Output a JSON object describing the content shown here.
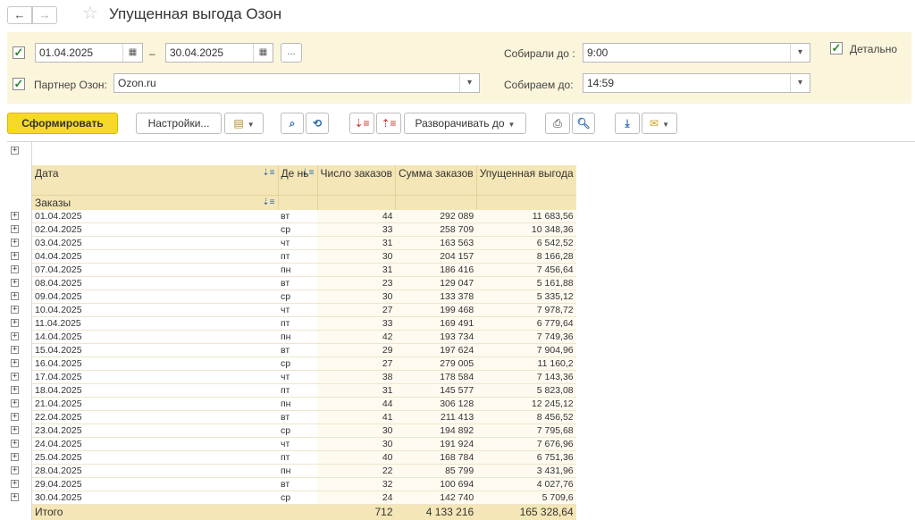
{
  "header": {
    "title": "Упущенная выгода Озон",
    "back_icon": "←",
    "forward_icon": "→",
    "star_icon": "☆"
  },
  "filters": {
    "period_from": "01.04.2025",
    "period_to": "30.04.2025",
    "period_sep": "–",
    "ellipsis": "...",
    "partner_label": "Партнер Озон:",
    "partner_value": "Ozon.ru",
    "collected_label": "Собирали до :",
    "collected_value": "9:00",
    "collecting_label": "Собираем до:",
    "collecting_value": "14:59",
    "detail_label": "Детально",
    "checkmark": "✓"
  },
  "toolbar": {
    "generate": "Сформировать",
    "settings": "Настройки...",
    "expand_to": "Разворачивать до"
  },
  "table": {
    "headers": {
      "date": "Дата",
      "day": "Де нь",
      "orders_count": "Число заказов",
      "orders_sum": "Сумма заказов",
      "lost_profit": "Упущенная выгода"
    },
    "group_label": "Заказы",
    "rows": [
      {
        "date": "01.04.2025",
        "day": "вт",
        "count": "44",
        "sum": "292 089",
        "lost": "11 683,56"
      },
      {
        "date": "02.04.2025",
        "day": "ср",
        "count": "33",
        "sum": "258 709",
        "lost": "10 348,36"
      },
      {
        "date": "03.04.2025",
        "day": "чт",
        "count": "31",
        "sum": "163 563",
        "lost": "6 542,52"
      },
      {
        "date": "04.04.2025",
        "day": "пт",
        "count": "30",
        "sum": "204 157",
        "lost": "8 166,28"
      },
      {
        "date": "07.04.2025",
        "day": "пн",
        "count": "31",
        "sum": "186 416",
        "lost": "7 456,64"
      },
      {
        "date": "08.04.2025",
        "day": "вт",
        "count": "23",
        "sum": "129 047",
        "lost": "5 161,88"
      },
      {
        "date": "09.04.2025",
        "day": "ср",
        "count": "30",
        "sum": "133 378",
        "lost": "5 335,12"
      },
      {
        "date": "10.04.2025",
        "day": "чт",
        "count": "27",
        "sum": "199 468",
        "lost": "7 978,72"
      },
      {
        "date": "11.04.2025",
        "day": "пт",
        "count": "33",
        "sum": "169 491",
        "lost": "6 779,64"
      },
      {
        "date": "14.04.2025",
        "day": "пн",
        "count": "42",
        "sum": "193 734",
        "lost": "7 749,36"
      },
      {
        "date": "15.04.2025",
        "day": "вт",
        "count": "29",
        "sum": "197 624",
        "lost": "7 904,96"
      },
      {
        "date": "16.04.2025",
        "day": "ср",
        "count": "27",
        "sum": "279 005",
        "lost": "11 160,2"
      },
      {
        "date": "17.04.2025",
        "day": "чт",
        "count": "38",
        "sum": "178 584",
        "lost": "7 143,36"
      },
      {
        "date": "18.04.2025",
        "day": "пт",
        "count": "31",
        "sum": "145 577",
        "lost": "5 823,08"
      },
      {
        "date": "21.04.2025",
        "day": "пн",
        "count": "44",
        "sum": "306 128",
        "lost": "12 245,12"
      },
      {
        "date": "22.04.2025",
        "day": "вт",
        "count": "41",
        "sum": "211 413",
        "lost": "8 456,52"
      },
      {
        "date": "23.04.2025",
        "day": "ср",
        "count": "30",
        "sum": "194 892",
        "lost": "7 795,68"
      },
      {
        "date": "24.04.2025",
        "day": "чт",
        "count": "30",
        "sum": "191 924",
        "lost": "7 676,96"
      },
      {
        "date": "25.04.2025",
        "day": "пт",
        "count": "40",
        "sum": "168 784",
        "lost": "6 751,36"
      },
      {
        "date": "28.04.2025",
        "day": "пн",
        "count": "22",
        "sum": "85 799",
        "lost": "3 431,96"
      },
      {
        "date": "29.04.2025",
        "day": "вт",
        "count": "32",
        "sum": "100 694",
        "lost": "4 027,76"
      },
      {
        "date": "30.04.2025",
        "day": "ср",
        "count": "24",
        "sum": "142 740",
        "lost": "5 709,6"
      }
    ],
    "total": {
      "label": "Итого",
      "count": "712",
      "sum": "4 133 216",
      "lost": "165 328,64"
    }
  },
  "colors": {
    "filter_bg": "#fbf5dc",
    "header_bg": "#f4e6b6",
    "primary_button": "#f6d928",
    "accent_blue": "#2f6fb0"
  },
  "icons": {
    "calendar": "calendar-icon",
    "dropdown": "dropdown-arrow-icon",
    "print": "printer-icon",
    "preview": "print-preview-icon",
    "search": "search-icon",
    "download": "download-icon",
    "mail": "envelope-icon",
    "expand": "plus-expand-icon"
  }
}
